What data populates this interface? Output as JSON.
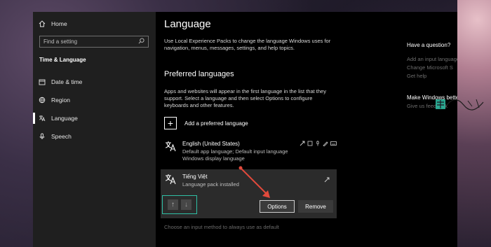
{
  "sidebar": {
    "home_label": "Home",
    "search_placeholder": "Find a setting",
    "section_title": "Time & Language",
    "items": [
      {
        "label": "Date & time",
        "icon": "calendar-clock-icon"
      },
      {
        "label": "Region",
        "icon": "globe-icon"
      },
      {
        "label": "Language",
        "icon": "language-icon"
      },
      {
        "label": "Speech",
        "icon": "microphone-icon"
      }
    ]
  },
  "main": {
    "title": "Language",
    "description": "Use Local Experience Packs to change the language Windows uses for navigation, menus, messages, settings, and help topics.",
    "preferred_heading": "Preferred languages",
    "preferred_desc": "Apps and websites will appear in the first language in the list that they support. Select a language and then select Options to configure keyboards and other features.",
    "add_language_label": "Add a preferred language",
    "languages": [
      {
        "name": "English (United States)",
        "sub1": "Default app language; Default input language",
        "sub2": "Windows display language"
      },
      {
        "name": "Tiếng Việt",
        "sub1": "Language pack installed"
      }
    ],
    "options_label": "Options",
    "remove_label": "Remove",
    "input_hint": "Choose an input method to always use as default"
  },
  "right": {
    "question": "Have a question?",
    "links": [
      "Add an input language",
      "Change Microsoft S",
      "Get help"
    ],
    "make_better": "Make Windows better",
    "feedback": "Give us feedback"
  },
  "colors": {
    "highlight_box": "#2fbfa5",
    "red_arrow": "#e24a3c"
  }
}
